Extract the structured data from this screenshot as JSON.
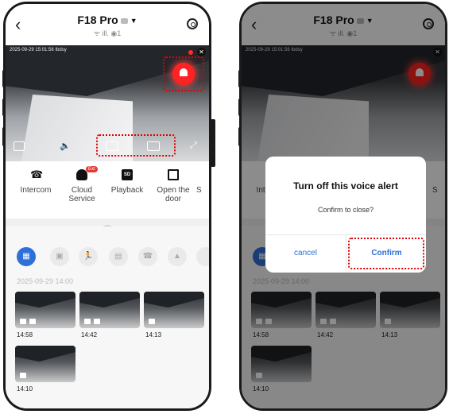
{
  "device": {
    "name": "F18 Pro",
    "status_text": "ᯤ ill. ◉1"
  },
  "video": {
    "timestamp": "2025-09-29 15:01:56 Ibdsy"
  },
  "functions": [
    {
      "label": "Intercom"
    },
    {
      "label": "Cloud Service",
      "badge": "Ext"
    },
    {
      "label": "Playback",
      "icon_text": "SD"
    },
    {
      "label": "Open the door"
    },
    {
      "label": "S"
    }
  ],
  "filters": {
    "all_icon": "grid-icon",
    "others": [
      "message-icon",
      "person-icon",
      "car-icon",
      "call-icon",
      "fire-icon"
    ]
  },
  "events": {
    "date_header": "2025-09-29 14:00",
    "items": [
      {
        "time": "14:58"
      },
      {
        "time": "14:42"
      },
      {
        "time": "14:13"
      },
      {
        "time": "14:10"
      }
    ]
  },
  "dialog": {
    "title": "Turn off this voice alert",
    "message": "Confirm to close?",
    "cancel_label": "cancel",
    "confirm_label": "Confirm"
  },
  "colors": {
    "accent": "#2f6fd8",
    "alarm": "#ff2222",
    "highlight": "#e00000"
  }
}
